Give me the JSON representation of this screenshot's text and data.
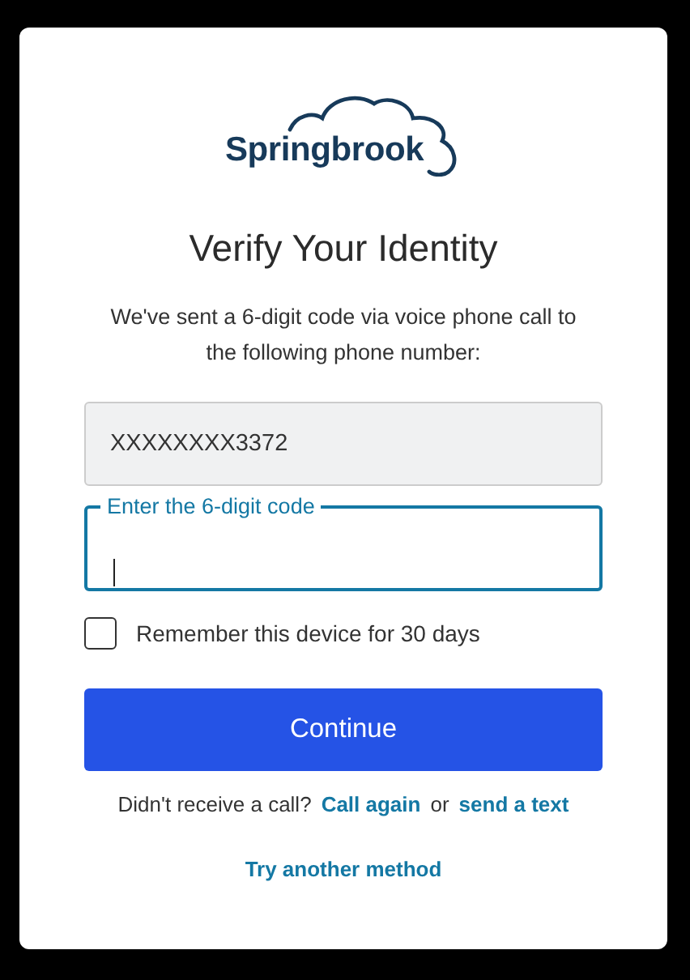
{
  "logo": {
    "text": "Springbrook"
  },
  "title": "Verify Your Identity",
  "description": "We've sent a 6-digit code via voice phone call to the following phone number:",
  "phone_field": {
    "value": "XXXXXXXX3372",
    "disabled": true
  },
  "code_field": {
    "label": "Enter the 6-digit code",
    "focused": true
  },
  "remember": {
    "label": "Remember this device for 30 days",
    "checked": false
  },
  "continue_button": "Continue",
  "resend": {
    "prompt": "Didn't receive a call?",
    "call_again": "Call again",
    "separator": "or",
    "send_text": "send a text"
  },
  "alt_link": "Try another method"
}
